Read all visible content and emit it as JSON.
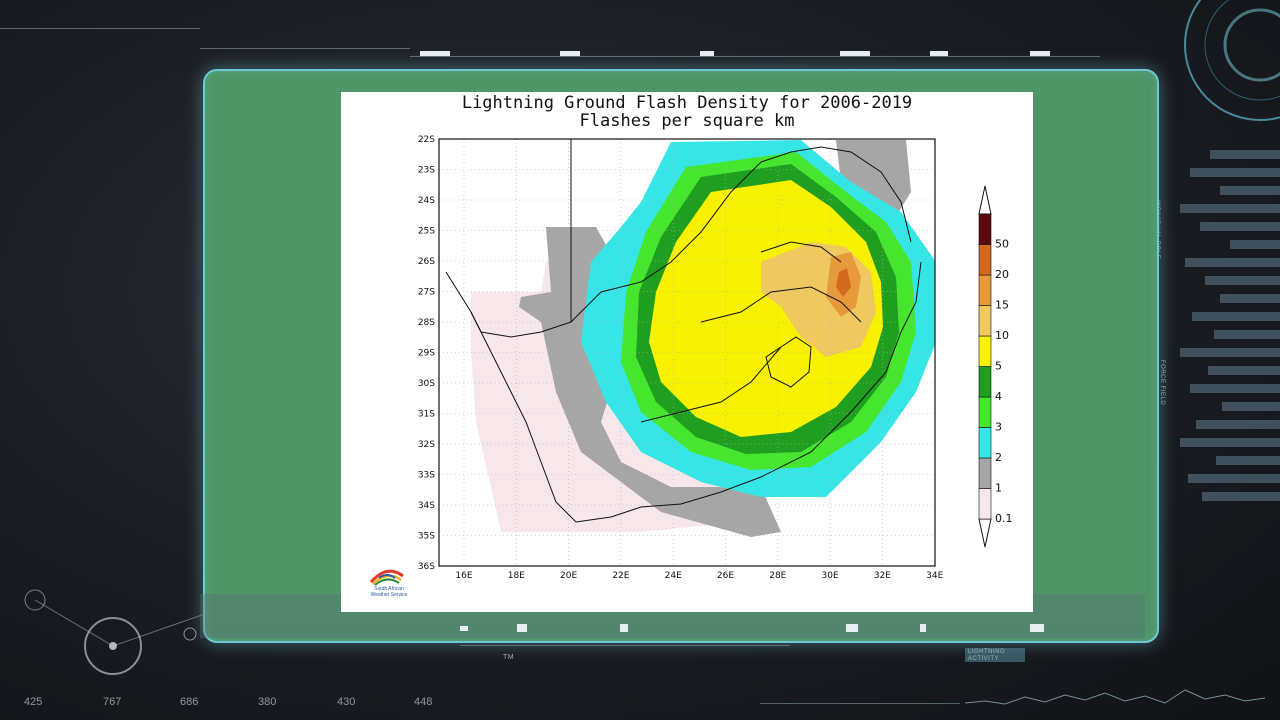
{
  "map": {
    "title": "Lightning Ground Flash Density for 2006-2019",
    "subtitle": "Flashes per square km",
    "lon_labels": [
      "16E",
      "18E",
      "20E",
      "22E",
      "24E",
      "26E",
      "28E",
      "30E",
      "32E",
      "34E"
    ],
    "lat_labels": [
      "22S",
      "23S",
      "24S",
      "25S",
      "26S",
      "27S",
      "28S",
      "29S",
      "30S",
      "31S",
      "32S",
      "33S",
      "34S",
      "35S",
      "36S"
    ],
    "legend": [
      {
        "label": "0.1",
        "color": "#f7e6ea"
      },
      {
        "label": "1",
        "color": "#a6a6a6"
      },
      {
        "label": "2",
        "color": "#36e6e6"
      },
      {
        "label": "3",
        "color": "#46e62f"
      },
      {
        "label": "4",
        "color": "#1f9e1f"
      },
      {
        "label": "5",
        "color": "#f8f200"
      },
      {
        "label": "10",
        "color": "#f0c860"
      },
      {
        "label": "15",
        "color": "#e69a3a"
      },
      {
        "label": "20",
        "color": "#d2691e"
      },
      {
        "label": "50",
        "color": "#5a0a0a"
      }
    ],
    "logo_text": "South African Weather Service"
  },
  "hud": {
    "readouts": [
      "425",
      "767",
      "686",
      "380",
      "430",
      "448"
    ],
    "tm_label": "TM",
    "side_label_1": "INDIVIDUAL ROLE",
    "side_label_2": "FORCE FIELD",
    "lightning_label": "LIGHTNING",
    "activity_label": "ACTIVITY"
  }
}
